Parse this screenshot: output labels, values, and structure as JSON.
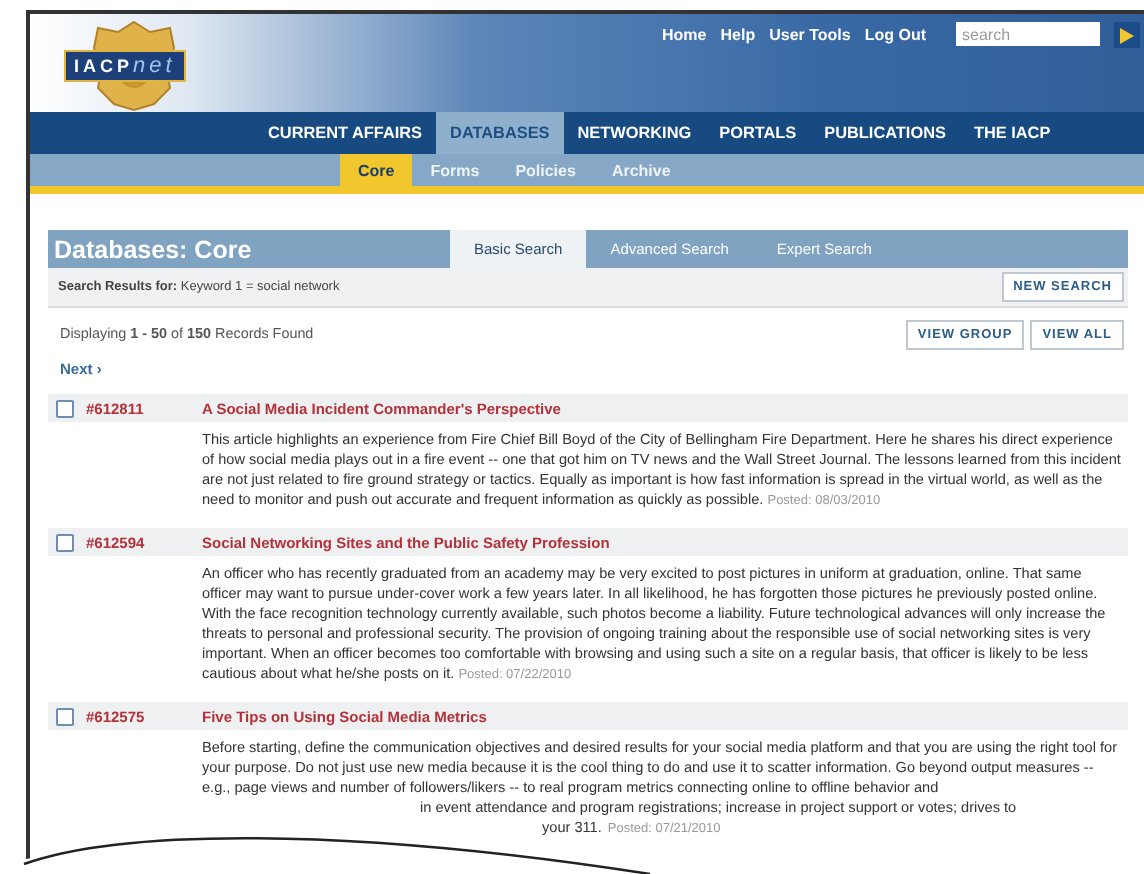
{
  "header": {
    "logo": {
      "text": "IACP",
      "accent": "net"
    },
    "top_links": [
      "Home",
      "Help",
      "User Tools",
      "Log Out"
    ],
    "search": {
      "placeholder": "search"
    }
  },
  "nav": [
    {
      "label": "CURRENT AFFAIRS",
      "selected": false
    },
    {
      "label": "DATABASES",
      "selected": true
    },
    {
      "label": "NETWORKING",
      "selected": false
    },
    {
      "label": "PORTALS",
      "selected": false
    },
    {
      "label": "PUBLICATIONS",
      "selected": false
    },
    {
      "label": "THE IACP",
      "selected": false
    }
  ],
  "subnav": [
    {
      "label": "Core",
      "selected": true
    },
    {
      "label": "Forms",
      "selected": false
    },
    {
      "label": "Policies",
      "selected": false
    },
    {
      "label": "Archive",
      "selected": false
    }
  ],
  "panel": {
    "title": "Databases: Core",
    "tabs": [
      {
        "label": "Basic Search",
        "selected": true
      },
      {
        "label": "Advanced Search",
        "selected": false
      },
      {
        "label": "Expert Search",
        "selected": false
      }
    ],
    "criteria": {
      "label": "Search Results for:",
      "value": "Keyword 1 = social network"
    },
    "new_search": "NEW SEARCH",
    "summary": "Displaying **1 - 50** of **150** Records Found",
    "buttons": [
      "VIEW GROUP",
      "VIEW ALL"
    ],
    "next": "Next ›"
  },
  "results": [
    {
      "id": "#612811",
      "checked": false,
      "title": "A Social Media Incident Commander's Perspective",
      "summary": "This article highlights an experience from Fire Chief Bill Boyd of the City of Bellingham Fire Department. Here he shares his direct experience of how social media plays out in a fire event -- one that got him on TV news and the Wall Street Journal. The lessons learned from this incident are not just related to fire ground strategy or tactics. Equally as important is how fast information is spread in the virtual world, as well as the need to monitor and push out accurate and frequent information as quickly as possible.",
      "posted": "Posted: 08/03/2010"
    },
    {
      "id": "#612594",
      "checked": false,
      "title": "Social Networking Sites and the Public Safety Profession",
      "summary": "An officer who has recently graduated from an academy may be very excited to post pictures in uniform at graduation, online. That same officer may want to pursue under-cover work a few years later. In all likelihood, he has forgotten those pictures he previously posted online. With the face recognition technology currently available, such photos become a liability. Future technological advances will only increase the threats to personal and professional security. The provision of ongoing training about the responsible use of social networking sites is very important. When an officer becomes too comfortable with browsing and using such a site on a regular basis, that officer is likely to be less cautious about what he/she posts on it.",
      "posted": "Posted: 07/22/2010"
    },
    {
      "id": "#612575",
      "checked": false,
      "title": "Five Tips on Using Social Media Metrics",
      "summary": "Before starting, define the communication objectives and desired results for your social media platform and that you are using the right tool for your purpose. Do not just use new media because it is the cool thing to do and use it to scatter information. Go beyond output measures -- e.g., page views and number of followers/likers -- to real program metrics connecting online to offline behavior and",
      "fragments": [
        "in event attendance and program registrations; increase in project support or votes; drives to",
        "your 311."
      ],
      "posted": "Posted: 07/21/2010"
    }
  ]
}
